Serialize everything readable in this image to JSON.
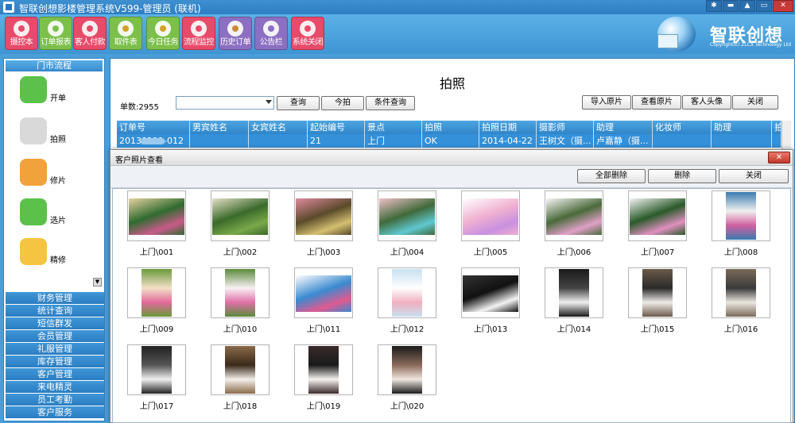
{
  "window": {
    "title": "智联创想影楼管理系统V599-管理员 (联机)",
    "controls": [
      {
        "name": "settings-icon",
        "glyph": "✱"
      },
      {
        "name": "minimize-icon",
        "glyph": "▬"
      },
      {
        "name": "skin-icon",
        "glyph": "▲"
      },
      {
        "name": "restore-icon",
        "glyph": "▭"
      },
      {
        "name": "close-icon",
        "glyph": "✕"
      }
    ]
  },
  "toolbar": {
    "buttons": [
      {
        "label": "摄控本",
        "color": "#e84a6a",
        "icon": "camera-book-icon",
        "dot": "#e84a6a"
      },
      {
        "label": "订单报表",
        "color": "#7cc04a",
        "icon": "order-report-icon",
        "dot": "#7cc04a"
      },
      {
        "label": "客人付款",
        "color": "#e84a6a",
        "icon": "payment-icon",
        "dot": "#e84a6a"
      },
      {
        "label": "取件表",
        "color": "#7cc04a",
        "icon": "pickup-icon",
        "dot": "#d4a02a"
      },
      {
        "label": "今日任务",
        "color": "#7cc04a",
        "icon": "task-icon",
        "dot": "#d4a02a"
      },
      {
        "label": "流程监控",
        "color": "#e84a6a",
        "icon": "monitor-icon",
        "dot": "#e84a6a"
      },
      {
        "label": "历史订单",
        "color": "#8b6fc2",
        "icon": "history-icon",
        "dot": "#c98a3a"
      },
      {
        "label": "公告栏",
        "color": "#8b6fc2",
        "icon": "notice-icon",
        "dot": "#8b6fc2"
      },
      {
        "label": "系统关闭",
        "color": "#e84a6a",
        "icon": "power-icon",
        "dot": "#e84a6a"
      }
    ]
  },
  "logo": {
    "name": "智联创想",
    "sub": "Copyright(c) ZLCX Technology Ltd"
  },
  "left": {
    "header": "门市流程",
    "items": [
      {
        "label": "开单",
        "color": "#5cc14a",
        "icon": "phone-icon"
      },
      {
        "label": "拍照",
        "color": "#d9d9d9",
        "icon": "camera-icon"
      },
      {
        "label": "修片",
        "color": "#f2a23a",
        "icon": "edit-icon"
      },
      {
        "label": "选片",
        "color": "#5cc14a",
        "icon": "select-photo-icon"
      },
      {
        "label": "精修",
        "color": "#f5c542",
        "icon": "weather-icon"
      }
    ],
    "menu": [
      "财务管理",
      "统计查询",
      "短信群发",
      "会员管理",
      "礼服管理",
      "库存管理",
      "客户管理",
      "来电精灵",
      "员工考勤",
      "客户服务"
    ]
  },
  "main": {
    "title": "拍照",
    "count_label": "单数:2955",
    "select_value": "",
    "buttons_left": [
      "查询",
      "今拍",
      "条件查询"
    ],
    "buttons_right": [
      "导入原片",
      "查看原片",
      "客人头像",
      "关闭"
    ],
    "columns": [
      "订单号",
      "男宾姓名",
      "女宾姓名",
      "起始编号",
      "景点",
      "拍照",
      "拍照日期",
      "摄影师",
      "助理",
      "化妆师",
      "助理",
      "拍"
    ],
    "selected_row": [
      "20130111-012",
      "",
      "",
      "21",
      "上门",
      "OK",
      "2014-04-22",
      "王树文（摄...",
      "卢嘉静（摄...",
      "",
      "",
      ""
    ]
  },
  "dialog": {
    "title": "客户照片查看",
    "close_glyph": "✕",
    "buttons": [
      "全部删除",
      "删除",
      "关闭"
    ],
    "photos": [
      {
        "caption": "上门\\001",
        "orient": "landscape",
        "colors": [
          "#2f6b2f",
          "#c85a8a",
          "#e8d2a0"
        ]
      },
      {
        "caption": "上门\\002",
        "orient": "landscape",
        "colors": [
          "#3a6a2a",
          "#7aa84a",
          "#e6e0c8"
        ]
      },
      {
        "caption": "上门\\003",
        "orient": "landscape",
        "colors": [
          "#5a4a2a",
          "#d4c070",
          "#e08aa0"
        ]
      },
      {
        "caption": "上门\\004",
        "orient": "landscape",
        "colors": [
          "#3f6a3a",
          "#5fc8d0",
          "#f0c0c8"
        ]
      },
      {
        "caption": "上门\\005",
        "orient": "landscape",
        "colors": [
          "#f0b0d0",
          "#c890e0",
          "#ffffff"
        ]
      },
      {
        "caption": "上门\\006",
        "orient": "landscape",
        "colors": [
          "#4a6a3a",
          "#e0a0c8",
          "#f6f6f6"
        ]
      },
      {
        "caption": "上门\\007",
        "orient": "landscape",
        "colors": [
          "#2a5a2a",
          "#e090c0",
          "#f4f4f4"
        ]
      },
      {
        "caption": "上门\\008",
        "orient": "portrait",
        "colors": [
          "#3a7ab0",
          "#d060a0",
          "#f0f0f0"
        ]
      },
      {
        "caption": "上门\\009",
        "orient": "portrait",
        "colors": [
          "#6a9a3a",
          "#e06a9a",
          "#f4e0c8"
        ]
      },
      {
        "caption": "上门\\010",
        "orient": "portrait",
        "colors": [
          "#5a8a3a",
          "#e070a8",
          "#f8f0f4"
        ]
      },
      {
        "caption": "上门\\011",
        "orient": "landscape",
        "colors": [
          "#3a8ad0",
          "#e05a90",
          "#ffffff"
        ]
      },
      {
        "caption": "上门\\012",
        "orient": "portrait",
        "colors": [
          "#c8e0f0",
          "#f0b0c0",
          "#ffffff"
        ]
      },
      {
        "caption": "上门\\013",
        "orient": "landscape",
        "colors": [
          "#111111",
          "#f4f4f4",
          "#333333"
        ]
      },
      {
        "caption": "上门\\014",
        "orient": "portrait",
        "colors": [
          "#1a1a1a",
          "#f0f0f0",
          "#444444"
        ]
      },
      {
        "caption": "上门\\015",
        "orient": "portrait",
        "colors": [
          "#6a5a4a",
          "#f0ece8",
          "#2a2a2a"
        ]
      },
      {
        "caption": "上门\\016",
        "orient": "portrait",
        "colors": [
          "#7a6a5a",
          "#ebe6e0",
          "#3a3a3a"
        ]
      },
      {
        "caption": "上门\\017",
        "orient": "portrait",
        "colors": [
          "#222222",
          "#f0f0f0",
          "#555555"
        ]
      },
      {
        "caption": "上门\\018",
        "orient": "portrait",
        "colors": [
          "#8a6a4a",
          "#f4f0ea",
          "#3a2a1a"
        ]
      },
      {
        "caption": "上门\\019",
        "orient": "portrait",
        "colors": [
          "#3a2a2a",
          "#f6f2f0",
          "#1a1a1a"
        ]
      },
      {
        "caption": "上门\\020",
        "orient": "portrait",
        "colors": [
          "#1a1a1a",
          "#f0e8e0",
          "#8a6a5a"
        ]
      }
    ]
  }
}
